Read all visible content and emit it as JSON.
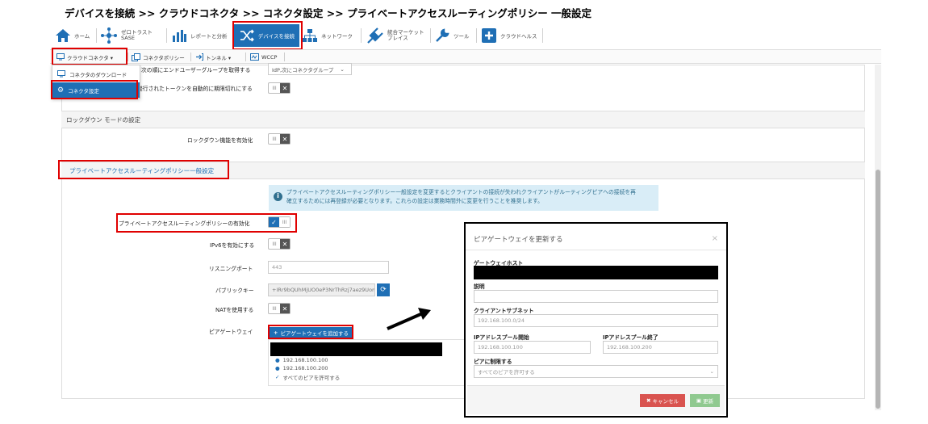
{
  "breadcrumb": "デバイスを接続 >> クラウドコネクタ >> コネクタ設定 >> プライベートアクセスルーティングポリシー 一般設定",
  "nav": {
    "home": "ホーム",
    "zerotrust_1": "ゼロトラスト",
    "zerotrust_2": "SASE",
    "reports": "レポートと分析",
    "connect": "デバイスを接続",
    "network": "ネットワーク",
    "marketplace_1": "統合マーケット",
    "marketplace_2": "プレイス",
    "tools": "ツール",
    "cloud_health": "クラウドヘルス"
  },
  "subnav": {
    "cloud_connector": "クラウドコネクタ ▾",
    "connector_policy": "コネクタポリシー",
    "tunnel": "トンネル ▾",
    "wccp": "WCCP"
  },
  "dropdown": {
    "download": "コネクタのダウンロード",
    "settings": "コネクタ設定"
  },
  "top_rows": {
    "fetch_label": "次の順にエンドユーザーグループを取得する",
    "fetch_value": "IdP,次にコネクタグループ",
    "token_label": "発行されたトークンを自動的に期限切れにする"
  },
  "lockdown": {
    "header": "ロックダウン モードの設定",
    "enable_label": "ロックダウン機能を有効化"
  },
  "private_access": {
    "header": "プライベートアクセスルーティングポリシー一般設定",
    "info_line1": "プライベートアクセスルーティングポリシー一般設定を変更するとクライアントの接続が失われクライアントがルーティングピアへの接続を再",
    "info_line2": "確立するためには再登録が必要となります。これらの設定は業務時間外に変更を行うことを推奨します。",
    "enable_label": "プライベートアクセスルーティングポリシーの有効化",
    "ipv6_label": "IPv6を有効にする",
    "port_label": "リスニングポート",
    "port_value": "443",
    "pubkey_label": "パブリックキー",
    "pubkey_value": "+IRr9bQUhMjUO0eP3NrThRzj7aez9Uomgc",
    "nat_label": "NATを使用する",
    "peer_gw_label": "ピアゲートウェイ",
    "add_peer_button": "ピアゲートウェイを追加する",
    "peer_ip1": "192.168.100.100",
    "peer_ip2": "192.168.100.200",
    "peer_allow": "すべてのピアを許可する"
  },
  "toggles": {
    "off_glyph": "III",
    "x_glyph": "✕",
    "check_glyph": "✓"
  },
  "modal": {
    "title": "ピアゲートウェイを更新する",
    "close": "×",
    "host_label": "ゲートウェイホスト",
    "desc_label": "説明",
    "subnet_label": "クライアントサブネット",
    "subnet_value": "192.168.100.0/24",
    "pool_start_label": "IPアドレスプール開始",
    "pool_start_value": "192.168.100.100",
    "pool_end_label": "IPアドレスプール終了",
    "pool_end_value": "192.168.100.200",
    "peer_limit_label": "ピアに制限する",
    "peer_limit_value": "すべてのピアを許可する",
    "cancel_button": "キャンセル",
    "update_button": "更新"
  },
  "colors": {
    "accent": "#1f6fb5",
    "highlight_red": "#e00000",
    "info_bg": "#d9edf7",
    "cancel": "#d9534f",
    "update": "#8fc98f"
  }
}
